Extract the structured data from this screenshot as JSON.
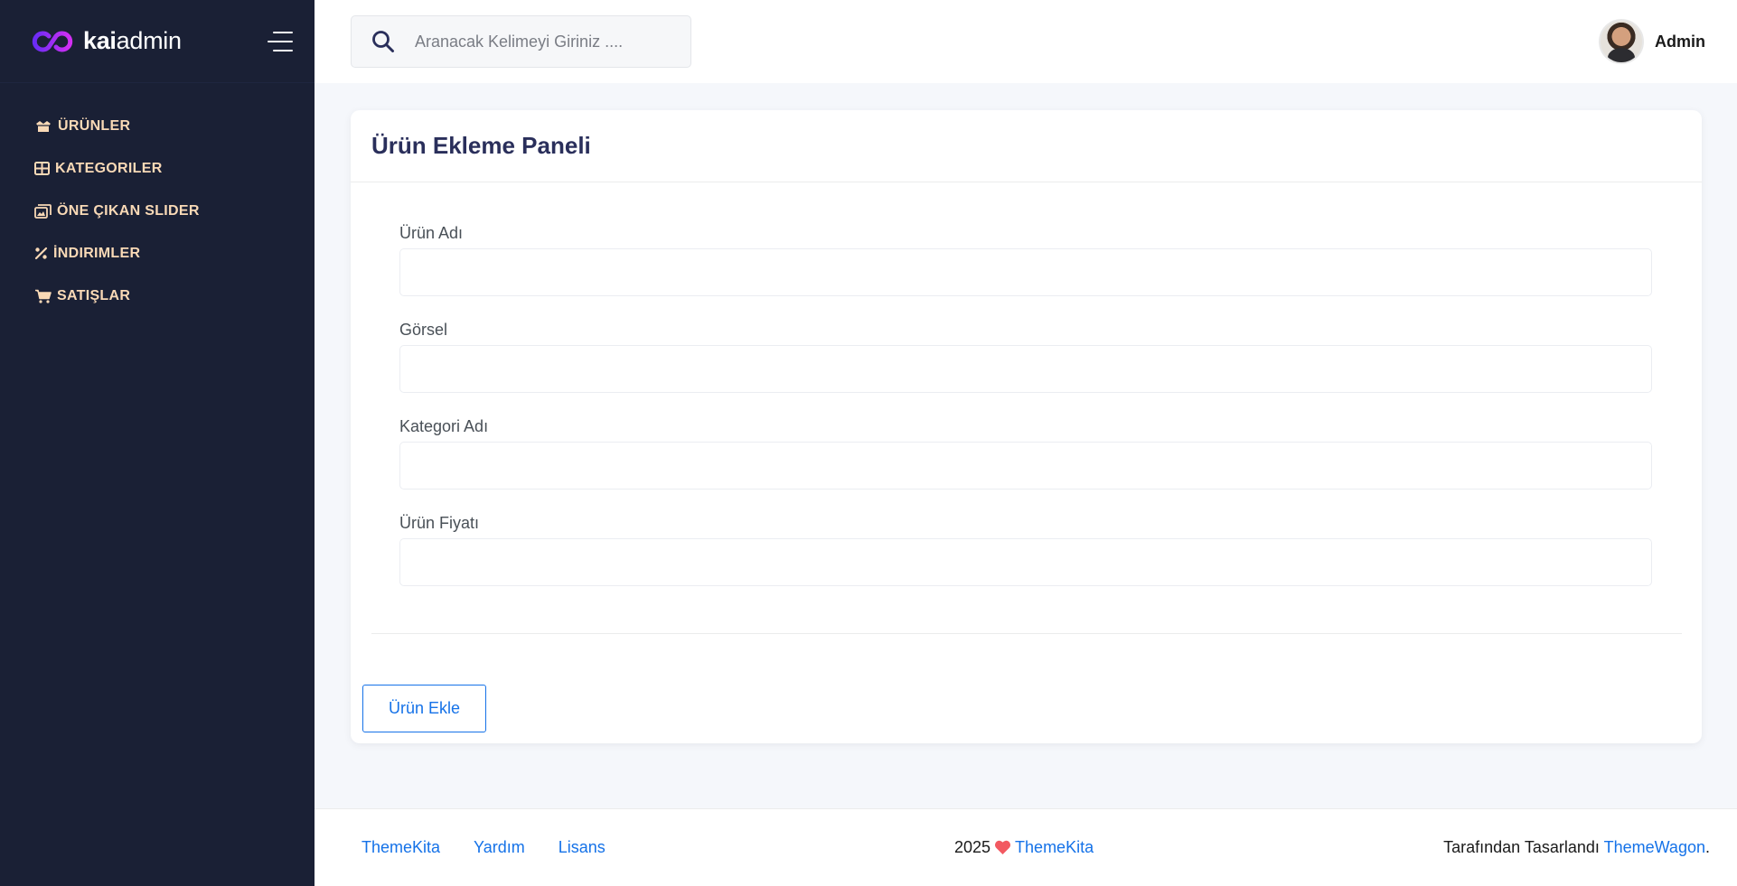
{
  "brand": {
    "bold": "kai",
    "light": "admin",
    "logo_color": "#a22ff4"
  },
  "sidebar": {
    "items": [
      {
        "label": "ÜRÜNLER",
        "icon": "box-open-icon"
      },
      {
        "label": "KATEGORILER",
        "icon": "grid-icon"
      },
      {
        "label": "ÖNE ÇIKAN SLIDER",
        "icon": "images-icon"
      },
      {
        "label": "İNDIRIMLER",
        "icon": "percent-icon"
      },
      {
        "label": "SATIŞLAR",
        "icon": "cart-icon"
      }
    ],
    "accent": "#f9d9b6",
    "background": "#1a2035"
  },
  "topbar": {
    "search_placeholder": "Aranacak Kelimeyi Giriniz ....",
    "user_name": "Admin"
  },
  "card": {
    "title": "Ürün Ekleme Paneli",
    "fields": [
      {
        "label": "Ürün Adı",
        "value": ""
      },
      {
        "label": "Görsel",
        "value": ""
      },
      {
        "label": "Kategori Adı",
        "value": ""
      },
      {
        "label": "Ürün Fiyatı",
        "value": ""
      }
    ],
    "submit_label": "Ürün Ekle"
  },
  "footer": {
    "links": [
      "ThemeKita",
      "Yardım",
      "Lisans"
    ],
    "year": "2025",
    "center_link": "ThemeKita",
    "right_text": "Tarafından Tasarlandı ",
    "right_link": "ThemeWagon",
    "right_suffix": "."
  },
  "colors": {
    "primary": "#1572e8",
    "heart": "#f25961"
  }
}
